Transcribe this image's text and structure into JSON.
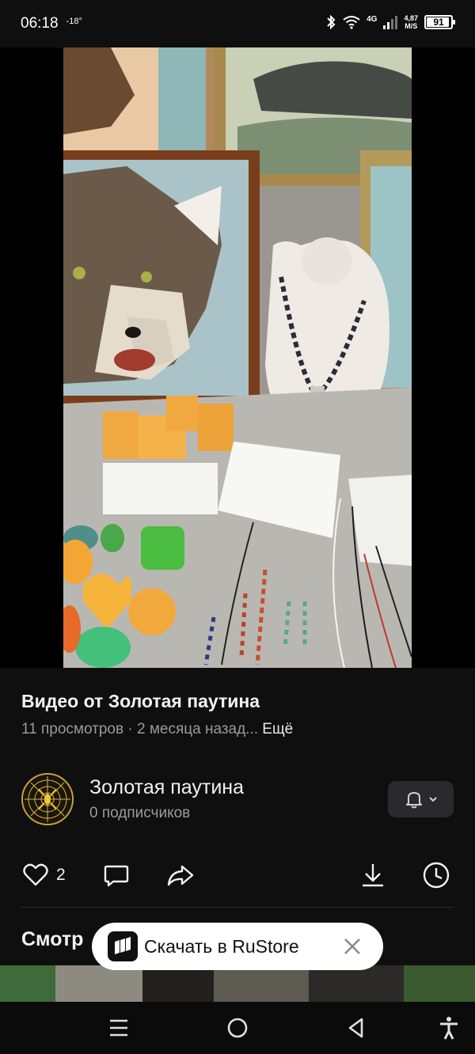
{
  "status_bar": {
    "time": "06:18",
    "temperature": "-18°",
    "network_type": "4G",
    "net_speed_value": "4,87",
    "net_speed_unit": "M/S",
    "battery": "91"
  },
  "video": {
    "title": "Видео от Золотая паутина",
    "views": "11 просмотров",
    "separator": " · ",
    "posted": "2 месяца назад...",
    "more_label": "Ещё"
  },
  "channel": {
    "name": "Золотая паутина",
    "subscribers": "0 подписчиков"
  },
  "actions": {
    "like_count": "2"
  },
  "section": {
    "watch_title": "Смотр"
  },
  "toast": {
    "label": "Скачать в RuStore"
  },
  "colors": {
    "background": "#0f0f10",
    "text": "#f2f2f2",
    "muted": "#9a9a9a",
    "button_bg": "#2a2a2c",
    "toast_bg": "#ffffff"
  }
}
